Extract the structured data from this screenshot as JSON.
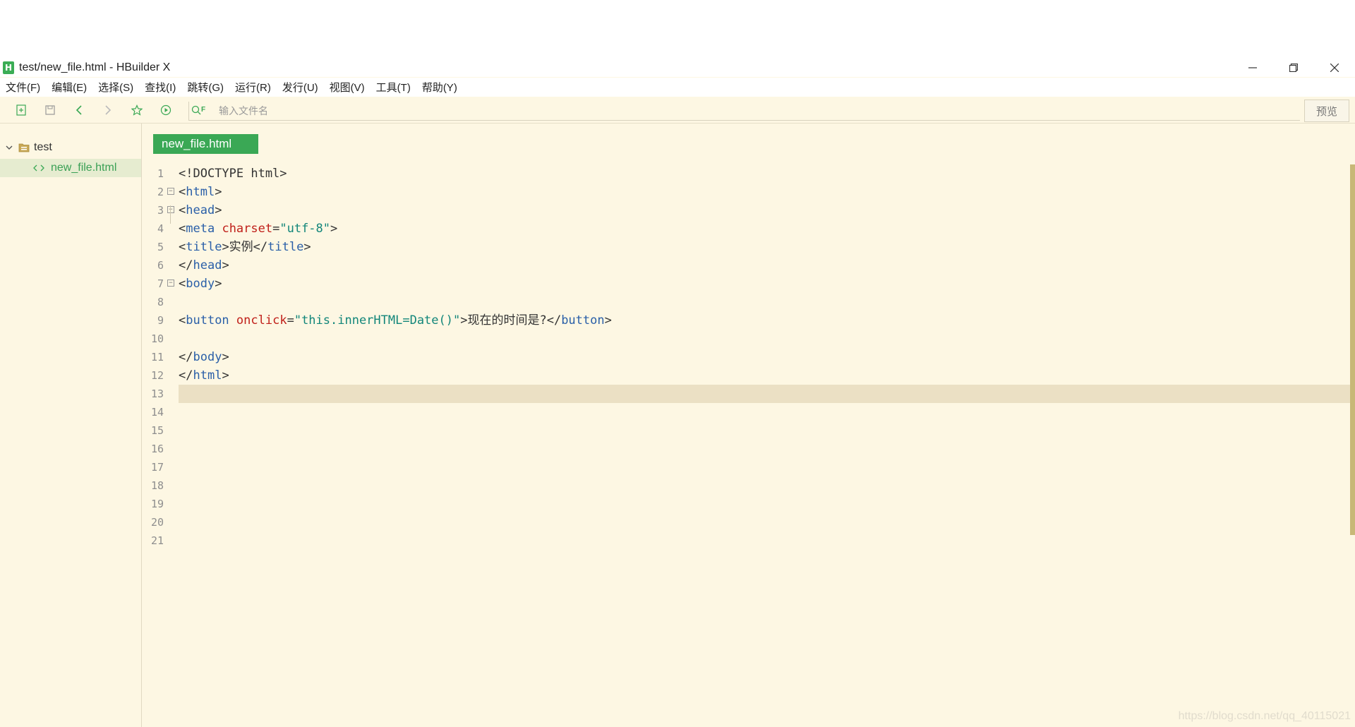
{
  "window": {
    "title": "test/new_file.html - HBuilder X",
    "app_icon_letter": "H"
  },
  "menu": [
    {
      "label": "文件(F)"
    },
    {
      "label": "编辑(E)"
    },
    {
      "label": "选择(S)"
    },
    {
      "label": "查找(I)"
    },
    {
      "label": "跳转(G)"
    },
    {
      "label": "运行(R)"
    },
    {
      "label": "发行(U)"
    },
    {
      "label": "视图(V)"
    },
    {
      "label": "工具(T)"
    },
    {
      "label": "帮助(Y)"
    }
  ],
  "toolbar": {
    "search_placeholder": "输入文件名",
    "preview_label": "预览",
    "search_prefix": "F"
  },
  "sidebar": {
    "project_name": "test",
    "file_name": "new_file.html"
  },
  "editor": {
    "active_tab": "new_file.html",
    "line_numbers": [
      "1",
      "2",
      "3",
      "4",
      "5",
      "6",
      "7",
      "8",
      "9",
      "10",
      "11",
      "12",
      "13",
      "14",
      "15",
      "16",
      "17",
      "18",
      "19",
      "20",
      "21"
    ],
    "current_line": 13,
    "lines": [
      {
        "segments": [
          {
            "t": "<!DOCTYPE html>",
            "c": "plain"
          }
        ]
      },
      {
        "segments": [
          {
            "t": "<",
            "c": "plain"
          },
          {
            "t": "html",
            "c": "tag"
          },
          {
            "t": ">",
            "c": "plain"
          }
        ]
      },
      {
        "segments": [
          {
            "t": "<",
            "c": "plain"
          },
          {
            "t": "head",
            "c": "tag"
          },
          {
            "t": ">",
            "c": "plain"
          }
        ]
      },
      {
        "segments": [
          {
            "t": "<",
            "c": "plain"
          },
          {
            "t": "meta",
            "c": "tag"
          },
          {
            "t": " ",
            "c": "plain"
          },
          {
            "t": "charset",
            "c": "attr"
          },
          {
            "t": "=",
            "c": "plain"
          },
          {
            "t": "\"utf-8\"",
            "c": "str"
          },
          {
            "t": ">",
            "c": "plain"
          }
        ]
      },
      {
        "segments": [
          {
            "t": "<",
            "c": "plain"
          },
          {
            "t": "title",
            "c": "tag"
          },
          {
            "t": ">实例</",
            "c": "plain"
          },
          {
            "t": "title",
            "c": "tag"
          },
          {
            "t": ">",
            "c": "plain"
          }
        ]
      },
      {
        "segments": [
          {
            "t": "</",
            "c": "plain"
          },
          {
            "t": "head",
            "c": "tag"
          },
          {
            "t": ">",
            "c": "plain"
          }
        ]
      },
      {
        "segments": [
          {
            "t": "<",
            "c": "plain"
          },
          {
            "t": "body",
            "c": "tag"
          },
          {
            "t": ">",
            "c": "plain"
          }
        ]
      },
      {
        "segments": []
      },
      {
        "segments": [
          {
            "t": "<",
            "c": "plain"
          },
          {
            "t": "button",
            "c": "tag"
          },
          {
            "t": " ",
            "c": "plain"
          },
          {
            "t": "onclick",
            "c": "attr"
          },
          {
            "t": "=",
            "c": "plain"
          },
          {
            "t": "\"this.innerHTML=Date()\"",
            "c": "str"
          },
          {
            "t": ">现在的时间是?</",
            "c": "plain"
          },
          {
            "t": "button",
            "c": "tag"
          },
          {
            "t": ">",
            "c": "plain"
          }
        ]
      },
      {
        "segments": []
      },
      {
        "segments": [
          {
            "t": "</",
            "c": "plain"
          },
          {
            "t": "body",
            "c": "tag"
          },
          {
            "t": ">",
            "c": "plain"
          }
        ]
      },
      {
        "segments": [
          {
            "t": "</",
            "c": "plain"
          },
          {
            "t": "html",
            "c": "tag"
          },
          {
            "t": ">",
            "c": "plain"
          }
        ]
      },
      {
        "segments": []
      },
      {
        "segments": []
      },
      {
        "segments": []
      },
      {
        "segments": []
      },
      {
        "segments": []
      },
      {
        "segments": []
      },
      {
        "segments": []
      },
      {
        "segments": []
      },
      {
        "segments": []
      }
    ]
  },
  "watermark": "https://blog.csdn.net/qq_40115021"
}
